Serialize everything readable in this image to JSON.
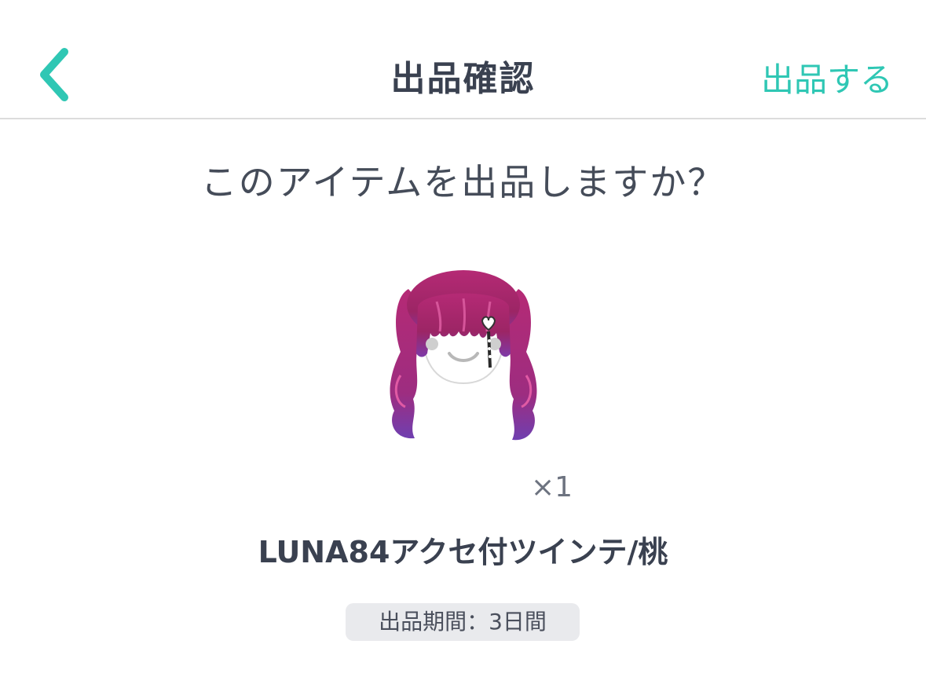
{
  "header": {
    "title": "出品確認",
    "submit_label": "出品する",
    "back_icon": "chevron-left-icon"
  },
  "main": {
    "question": "このアイテムを出品しますか？",
    "item": {
      "image": "twin-tail-hair-icon",
      "quantity": "×1",
      "name": "LUNA84アクセ付ツインテ/桃"
    },
    "period_badge": "出品期間：3日間"
  },
  "colors": {
    "accent": "#2fc7b4",
    "text": "#3a4150",
    "badge_bg": "#e9eaed",
    "hair": "#a8286e"
  }
}
